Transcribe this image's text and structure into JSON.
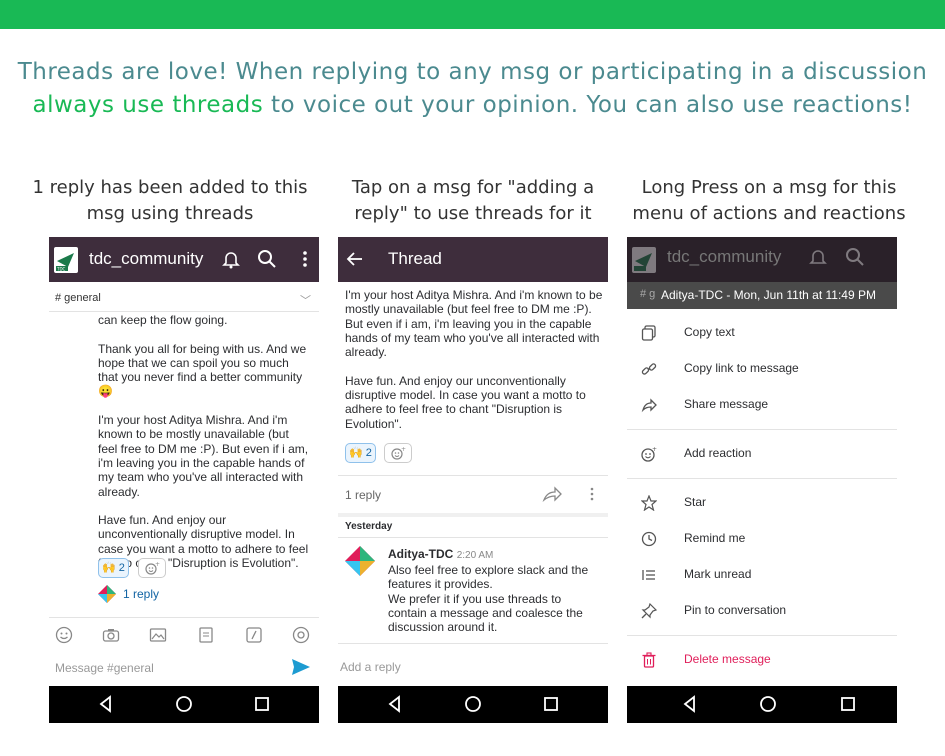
{
  "headline": {
    "line1": "Threads are love! When replying to any msg or participating in a discussion",
    "line2_highlight": "always use threads",
    "line2_rest": " to voice out your opinion. You can also use reactions!"
  },
  "captions": [
    "1 reply has been added to this msg using threads",
    "Tap on a msg for \"adding a reply\" to use threads for it",
    "Long Press on a msg for this menu of actions and reactions"
  ],
  "colors": {
    "brand_green": "#19b955",
    "slack_aubergine": "#3e2d3c",
    "danger": "#e01e5a",
    "link": "#1264a3"
  },
  "phone1": {
    "title": "tdc_community",
    "channel": "# general",
    "message": "can keep the flow going.\n\nThank you all for being with us. And we hope that we can spoil you so much that you never find a better community 😛\n\nI'm your host Aditya Mishra. And i'm known to be mostly unavailable (but feel free to DM me :P). But even if i am, i'm leaving you in the capable hands of my team who you've all interacted with already.\n\nHave fun. And enjoy our unconventionally disruptive model. In case you want a motto to adhere to feel free to chant \"Disruption is Evolution\".",
    "reaction_emoji": "🙌",
    "reaction_count": "2",
    "replies": "1 reply",
    "composer_placeholder": "Message #general"
  },
  "phone2": {
    "title": "Thread",
    "message": "I'm your host Aditya Mishra. And i'm known to be mostly unavailable (but feel free to DM me :P). But even if i am, i'm leaving you in the capable hands of my team who you've all interacted with already.\n\nHave fun. And enjoy our unconventionally disruptive model. In case you want a motto to adhere to feel free to chant \"Disruption is Evolution\".",
    "reaction_emoji": "🙌",
    "reaction_count": "2",
    "replies": "1 reply",
    "day_divider": "Yesterday",
    "reply_author": "Aditya-TDC",
    "reply_time": "2:20 AM",
    "reply_text": "Also feel free to explore slack and the features it provides.\nWe prefer it if you use threads to contain a message and coalesce the discussion around it.",
    "composer_placeholder": "Add a reply"
  },
  "phone3": {
    "title": "tdc_community",
    "channel": "# g",
    "menu_header": "Aditya-TDC - Mon, Jun 11th at 11:49 PM",
    "group1": [
      "Copy text",
      "Copy link to message",
      "Share message"
    ],
    "group2": [
      "Add reaction"
    ],
    "group3": [
      "Star",
      "Remind me",
      "Mark unread",
      "Pin to conversation"
    ],
    "danger": "Delete message"
  }
}
